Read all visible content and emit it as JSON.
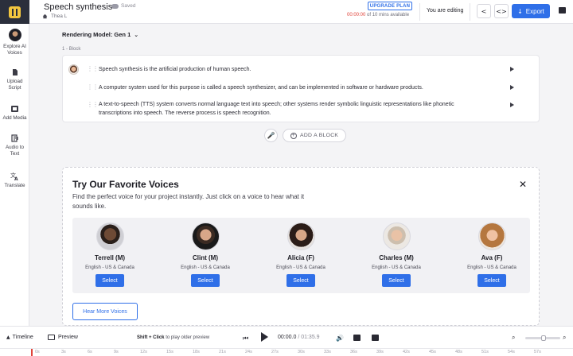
{
  "header": {
    "title": "Speech synthesis",
    "saved_label": "Saved",
    "breadcrumb_user": "Thea L",
    "upgrade_label": "UPGRADE PLAN",
    "minutes_used": "00:00:00",
    "minutes_rest": "of 10 mins available",
    "editing_label": "You are editing",
    "export_label": "Export"
  },
  "sidebar": {
    "items": [
      {
        "label": "Explore AI Voices",
        "icon": "voice-avatar-icon"
      },
      {
        "label": "Upload Script",
        "icon": "upload-icon"
      },
      {
        "label": "Add Media",
        "icon": "media-icon"
      },
      {
        "label": "Audio to Text",
        "icon": "audio-text-icon"
      },
      {
        "label": "Translate",
        "icon": "translate-icon"
      }
    ]
  },
  "editor": {
    "model_label": "Rendering Model: Gen 1",
    "block_label": "1 -   Block",
    "sentences": [
      "Speech synthesis is the artificial production of human speech.",
      "A computer system used for this purpose is called a speech synthesizer, and can be implemented in software or hardware products.",
      "A text-to-speech (TTS) system converts normal language text into speech; other systems render symbolic linguistic representations like phonetic transcriptions into speech. The reverse process is speech recognition."
    ],
    "add_block_label": "ADD A BLOCK"
  },
  "voices_panel": {
    "title": "Try Our Favorite Voices",
    "subtitle": "Find the perfect voice for your project instantly. Just click on a voice to hear what it sounds like.",
    "voices": [
      {
        "name": "Terrell (M)",
        "lang": "English - US & Canada",
        "select": "Select"
      },
      {
        "name": "Clint (M)",
        "lang": "English - US & Canada",
        "select": "Select"
      },
      {
        "name": "Alicia (F)",
        "lang": "English - US & Canada",
        "select": "Select"
      },
      {
        "name": "Charles (M)",
        "lang": "English - US & Canada",
        "select": "Select"
      },
      {
        "name": "Ava (F)",
        "lang": "English - US & Canada",
        "select": "Select"
      }
    ],
    "hear_more_label": "Hear More Voices"
  },
  "timeline": {
    "toggle_label": "Timeline",
    "preview_label": "Preview",
    "hint_bold": "Shift + Click",
    "hint_rest": "to play older preview",
    "current_time": "00:00.0",
    "total_time": "/ 01:35.9",
    "ruler_ticks": [
      "0s",
      "3s",
      "6s",
      "9s",
      "12s",
      "15s",
      "18s",
      "21s",
      "24s",
      "27s",
      "30s",
      "33s",
      "36s",
      "39s",
      "42s",
      "45s",
      "48s",
      "51s",
      "54s",
      "57s"
    ]
  },
  "colors": {
    "accent": "#2f6fe8",
    "logo_bg": "#2b2f3c",
    "logo_mark": "#f3c63f",
    "alert": "#e0433a"
  }
}
